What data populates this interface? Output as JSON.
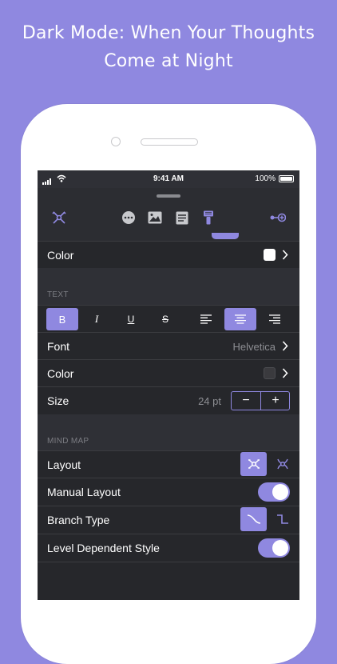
{
  "headline": {
    "line1": "Dark Mode: When Your Thoughts",
    "line2": "Come at Night"
  },
  "status_bar": {
    "time": "9:41 AM",
    "battery": "100%"
  },
  "toolbar": {
    "icons": [
      "mindmap-layout-icon",
      "more-icon",
      "image-icon",
      "notes-icon",
      "format-brush-icon",
      "connect-icon"
    ],
    "active": "format-brush-icon"
  },
  "style_section": {
    "color_label": "Color",
    "color_value": "#ffffff"
  },
  "text_section": {
    "title": "TEXT",
    "format_buttons": [
      "B",
      "I",
      "U",
      "S"
    ],
    "bold_active": true,
    "alignment": "center",
    "font_label": "Font",
    "font_value": "Helvetica",
    "color_label": "Color",
    "color_value": "#3a3a3e",
    "size_label": "Size",
    "size_value": "24 pt",
    "stepper_minus": "−",
    "stepper_plus": "+"
  },
  "mind_map_section": {
    "title": "MIND MAP",
    "layout_label": "Layout",
    "layout_selected": "mindmap",
    "manual_layout_label": "Manual Layout",
    "manual_layout_on": true,
    "branch_type_label": "Branch Type",
    "branch_type_selected": "curved",
    "level_style_label": "Level Dependent Style",
    "level_style_on": true
  },
  "colors": {
    "accent": "#8f88e0",
    "background_outer": "#8f88e0",
    "panel": "#26272b"
  }
}
